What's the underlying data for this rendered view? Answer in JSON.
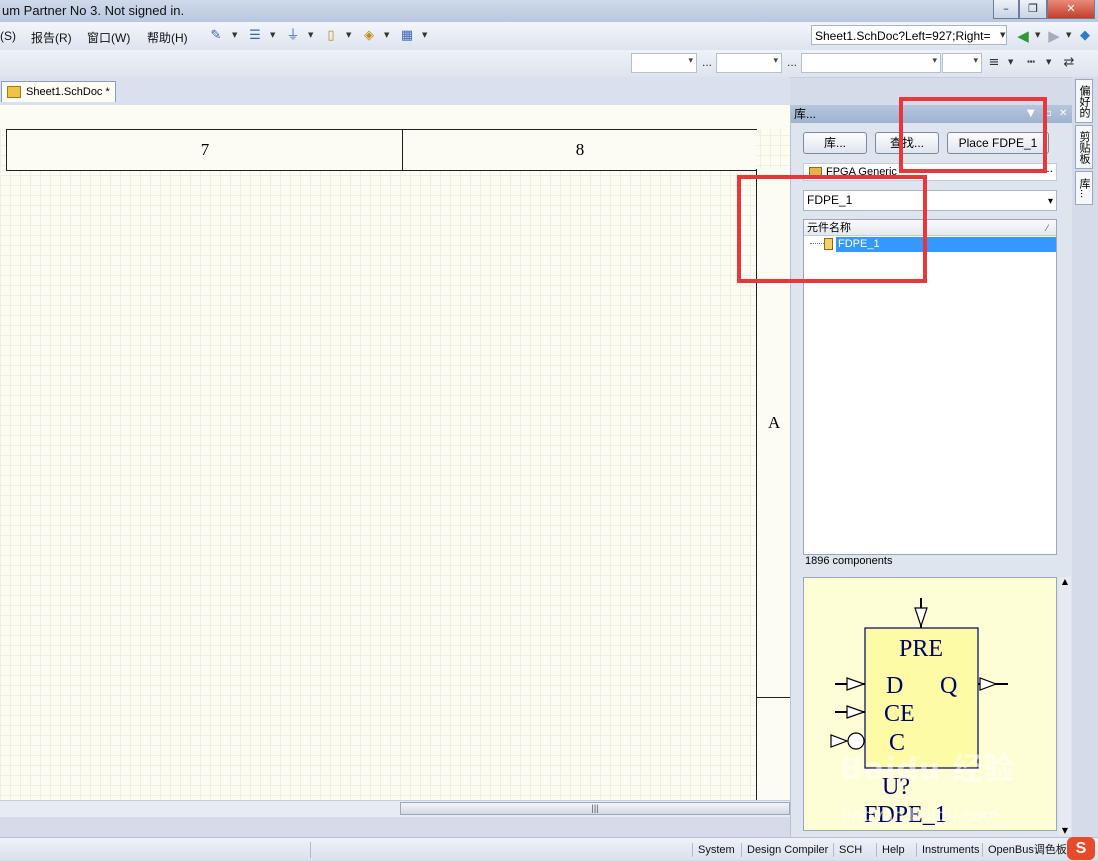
{
  "window": {
    "title": "um Partner No 3. Not signed in.",
    "controls": [
      "minimize",
      "maximize",
      "close"
    ]
  },
  "menubar": {
    "items": [
      "(S)",
      "报告(R)",
      "窗口(W)",
      "帮助(H)"
    ],
    "address": "Sheet1.SchDoc?Left=927;Right="
  },
  "tabs": {
    "document": "Sheet1.SchDoc *"
  },
  "sheet": {
    "zones": [
      "7",
      "8"
    ],
    "row_label": "A"
  },
  "library_panel": {
    "title": "库...",
    "buttons": [
      "库...",
      "查找...",
      "Place FDPE_1"
    ],
    "library": "FPGA Generic",
    "filter": "FDPE_1",
    "column_header": "元件名称",
    "components": [
      "FDPE_1"
    ],
    "count_text": "1896 components",
    "preview": {
      "pins": [
        "PRE",
        "D",
        "Q",
        "CE",
        "C"
      ],
      "designator": "U?",
      "name": "FDPE_1"
    }
  },
  "side_tabs": [
    "偏好的",
    "剪贴板",
    "库..."
  ],
  "status_bar": [
    "System",
    "Design Compiler",
    "SCH",
    "Help",
    "Instruments",
    "OpenBus调色板"
  ],
  "watermark": {
    "line1": "Baidu 经验",
    "line2": "jingyan.baidu.com"
  },
  "colors": {
    "annotation": "#e8363a",
    "selection": "#3399ff",
    "preview_bg": "#fefed6",
    "symbol_fill": "#fdfba5",
    "symbol_text": "#000066"
  }
}
